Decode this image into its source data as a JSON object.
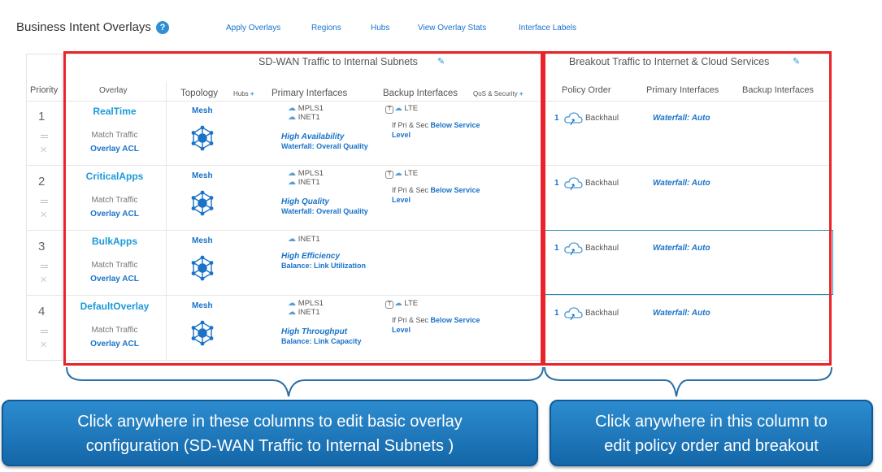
{
  "header": {
    "title": "Business Intent Overlays",
    "help": "?",
    "nav": [
      "Apply Overlays",
      "Regions",
      "Hubs",
      "View Overlay Stats",
      "Interface Labels"
    ]
  },
  "groups": {
    "sdwan": "SD-WAN Traffic to Internal Subnets",
    "breakout": "Breakout Traffic to Internet & Cloud Services"
  },
  "columns": {
    "priority": "Priority",
    "overlay": "Overlay",
    "topology": "Topology",
    "hubs": "Hubs",
    "primary": "Primary Interfaces",
    "backup": "Backup Interfaces",
    "qos": "QoS & Security",
    "plus": "+",
    "policy_order": "Policy Order",
    "bo_primary": "Primary Interfaces",
    "bo_backup": "Backup Interfaces"
  },
  "rows": [
    {
      "priority": "1",
      "name": "RealTime",
      "match": "Match Traffic",
      "acl": "Overlay ACL",
      "topology": "Mesh",
      "primary": [
        "MPLS1",
        "INET1"
      ],
      "quality": "High Availability",
      "mode": "Waterfall: Overall Quality",
      "backup": "LTE",
      "cond_prefix": "If Pri & Sec ",
      "cond_link1": "Below Service",
      "cond_link2": "Level",
      "po_num": "1",
      "po_label": "Backhaul",
      "bo_primary": "Waterfall: Auto"
    },
    {
      "priority": "2",
      "name": "CriticalApps",
      "match": "Match Traffic",
      "acl": "Overlay ACL",
      "topology": "Mesh",
      "primary": [
        "MPLS1",
        "INET1"
      ],
      "quality": "High Quality",
      "mode": "Waterfall: Overall Quality",
      "backup": "LTE",
      "cond_prefix": "If Pri & Sec ",
      "cond_link1": "Below Service",
      "cond_link2": "Level",
      "po_num": "1",
      "po_label": "Backhaul",
      "bo_primary": "Waterfall: Auto"
    },
    {
      "priority": "3",
      "name": "BulkApps",
      "match": "Match Traffic",
      "acl": "Overlay ACL",
      "topology": "Mesh",
      "primary": [
        "INET1"
      ],
      "quality": "High Efficiency",
      "mode": "Balance: Link Utilization",
      "backup": "",
      "cond_prefix": "",
      "cond_link1": "",
      "cond_link2": "",
      "po_num": "1",
      "po_label": "Backhaul",
      "bo_primary": "Waterfall: Auto"
    },
    {
      "priority": "4",
      "name": "DefaultOverlay",
      "match": "Match Traffic",
      "acl": "Overlay ACL",
      "topology": "Mesh",
      "primary": [
        "MPLS1",
        "INET1"
      ],
      "quality": "High Throughput",
      "mode": "Balance: Link Capacity",
      "backup": "LTE",
      "cond_prefix": "If Pri & Sec ",
      "cond_link1": "Below Service",
      "cond_link2": "Level",
      "po_num": "1",
      "po_label": "Backhaul",
      "bo_primary": "Waterfall: Auto"
    }
  ],
  "callouts": {
    "left": [
      "Click anywhere in these columns to edit basic overlay",
      "configuration (SD-WAN Traffic to Internal Subnets )"
    ],
    "right": [
      "Click anywhere in this column to",
      "edit policy order and breakout"
    ]
  },
  "colors": {
    "accent": "#1a9ad9",
    "link": "#1a73c9",
    "red_box": "#e8232a",
    "callout": "#1f77bb"
  },
  "icons": {
    "help": "help-icon",
    "edit": "pencil-icon",
    "topology": "mesh-topology-icon",
    "cloud": "cloud-icon",
    "breakout": "cloud-arrow-icon",
    "lock": "lock-icon",
    "drag": "drag-handle-icon",
    "delete": "close-icon"
  }
}
